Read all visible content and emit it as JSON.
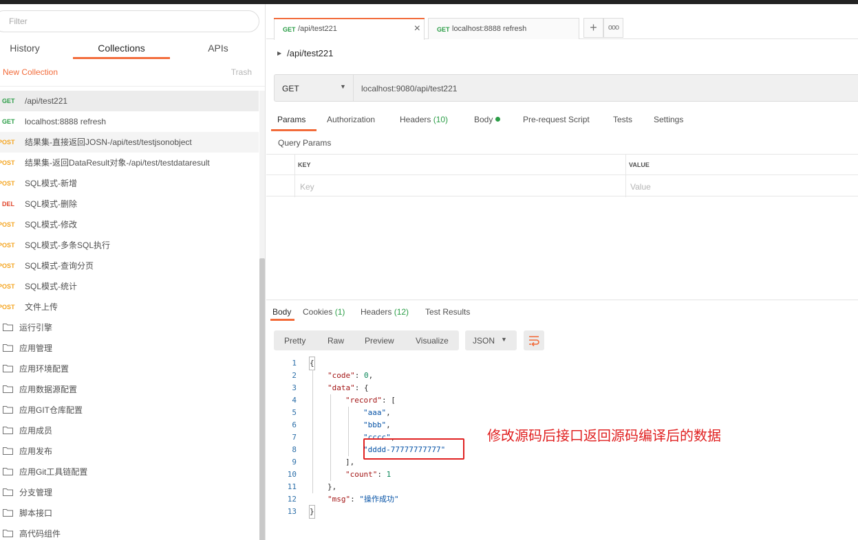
{
  "sidebar": {
    "filter_placeholder": "Filter",
    "tabs": [
      "History",
      "Collections",
      "APIs"
    ],
    "new_collection": "New Collection",
    "trash": "Trash",
    "requests": [
      {
        "method": "GET",
        "name": "/api/test221"
      },
      {
        "method": "GET",
        "name": "localhost:8888 refresh"
      },
      {
        "method": "POST",
        "name": "结果集-直接返回JOSN-/api/test/testjsonobject"
      },
      {
        "method": "POST",
        "name": "结果集-返回DataResult对象-/api/test/testdataresult"
      },
      {
        "method": "POST",
        "name": "SQL模式-新增"
      },
      {
        "method": "DEL",
        "name": "SQL模式-删除"
      },
      {
        "method": "POST",
        "name": "SQL模式-修改"
      },
      {
        "method": "POST",
        "name": "SQL模式-多条SQL执行"
      },
      {
        "method": "POST",
        "name": "SQL模式-查询分页"
      },
      {
        "method": "POST",
        "name": "SQL模式-统计"
      },
      {
        "method": "POST",
        "name": "文件上传"
      }
    ],
    "folders": [
      "运行引擎",
      "应用管理",
      "应用环境配置",
      "应用数据源配置",
      "应用GIT仓库配置",
      "应用成员",
      "应用发布",
      "应用Git工具链配置",
      "分支管理",
      "脚本接口",
      "高代码组件"
    ]
  },
  "tabs": [
    {
      "method": "GET",
      "name": "/api/test221"
    },
    {
      "method": "GET",
      "name": "localhost:8888 refresh"
    }
  ],
  "request": {
    "breadcrumb": "/api/test221",
    "method": "GET",
    "url": "localhost:9080/api/test221",
    "tabs": {
      "params": "Params",
      "authorization": "Authorization",
      "headers": "Headers",
      "headers_count": "(10)",
      "body": "Body",
      "prerequest": "Pre-request Script",
      "tests": "Tests",
      "settings": "Settings"
    },
    "query_params_title": "Query Params",
    "table": {
      "key_header": "KEY",
      "value_header": "VALUE",
      "key_placeholder": "Key",
      "value_placeholder": "Value"
    }
  },
  "response": {
    "tabs": {
      "body": "Body",
      "cookies": "Cookies",
      "cookies_count": "(1)",
      "headers": "Headers",
      "headers_count": "(12)",
      "test_results": "Test Results"
    },
    "view_modes": [
      "Pretty",
      "Raw",
      "Preview",
      "Visualize"
    ],
    "format": "JSON",
    "annotation": "修改源码后接口返回源码编译后的数据",
    "code_lines": [
      {
        "n": "1",
        "indent": 0,
        "tokens": [
          {
            "t": "p",
            "v": "{"
          }
        ]
      },
      {
        "n": "2",
        "indent": 1,
        "tokens": [
          {
            "t": "key",
            "v": "\"code\""
          },
          {
            "t": "p",
            "v": ": "
          },
          {
            "t": "num",
            "v": "0"
          },
          {
            "t": "p",
            "v": ","
          }
        ]
      },
      {
        "n": "3",
        "indent": 1,
        "tokens": [
          {
            "t": "key",
            "v": "\"data\""
          },
          {
            "t": "p",
            "v": ": {"
          }
        ]
      },
      {
        "n": "4",
        "indent": 2,
        "tokens": [
          {
            "t": "key",
            "v": "\"record\""
          },
          {
            "t": "p",
            "v": ": ["
          }
        ]
      },
      {
        "n": "5",
        "indent": 3,
        "tokens": [
          {
            "t": "str",
            "v": "\"aaa\""
          },
          {
            "t": "p",
            "v": ","
          }
        ]
      },
      {
        "n": "6",
        "indent": 3,
        "tokens": [
          {
            "t": "str",
            "v": "\"bbb\""
          },
          {
            "t": "p",
            "v": ","
          }
        ]
      },
      {
        "n": "7",
        "indent": 3,
        "tokens": [
          {
            "t": "str",
            "v": "\"cccc\""
          },
          {
            "t": "p",
            "v": ","
          }
        ]
      },
      {
        "n": "8",
        "indent": 3,
        "tokens": [
          {
            "t": "str",
            "v": "\"dddd-77777777777\""
          }
        ]
      },
      {
        "n": "9",
        "indent": 2,
        "tokens": [
          {
            "t": "p",
            "v": "],"
          }
        ]
      },
      {
        "n": "10",
        "indent": 2,
        "tokens": [
          {
            "t": "key",
            "v": "\"count\""
          },
          {
            "t": "p",
            "v": ": "
          },
          {
            "t": "num",
            "v": "1"
          }
        ]
      },
      {
        "n": "11",
        "indent": 1,
        "tokens": [
          {
            "t": "p",
            "v": "},"
          }
        ]
      },
      {
        "n": "12",
        "indent": 1,
        "tokens": [
          {
            "t": "key",
            "v": "\"msg\""
          },
          {
            "t": "p",
            "v": ": "
          },
          {
            "t": "str",
            "v": "\"操作成功\""
          }
        ]
      },
      {
        "n": "13",
        "indent": 0,
        "tokens": [
          {
            "t": "p",
            "v": "}"
          }
        ]
      }
    ]
  },
  "colors": {
    "accent": "#f26b3a",
    "get": "#2a9d46",
    "post": "#f4a521",
    "delete": "#e0452a",
    "annotation": "#e02020"
  },
  "icons": {
    "folder": "folder-icon",
    "close": "close-icon",
    "add_tab": "plus-icon",
    "more_tabs": "more-icon",
    "wrap": "wrap-lines-icon"
  }
}
